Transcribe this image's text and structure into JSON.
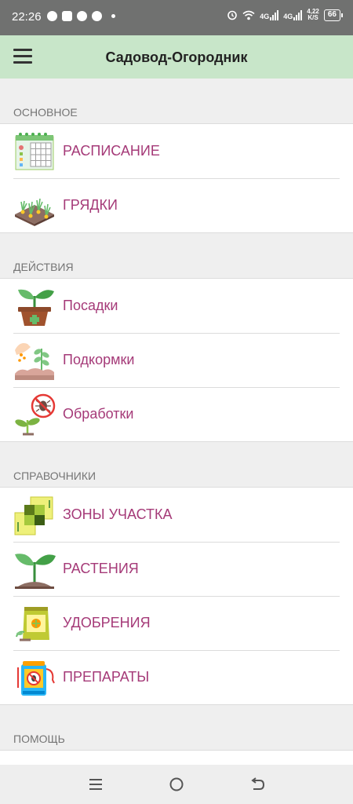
{
  "status_bar": {
    "time": "22:26",
    "net_speed_value": "4,22",
    "net_speed_unit": "K/S",
    "net_type_1": "4G",
    "net_type_2": "4G",
    "battery": "66"
  },
  "app_bar": {
    "title": "Садовод-Огородник",
    "menu_icon": "hamburger-icon",
    "background": "#c8e6c9"
  },
  "colors": {
    "item_text": "#a53a78",
    "section_text": "#757575"
  },
  "sections": [
    {
      "title": "ОСНОВНОЕ",
      "items": [
        {
          "label": "РАСПИСАНИЕ",
          "icon": "calendar-icon"
        },
        {
          "label": "ГРЯДКИ",
          "icon": "garden-bed-icon"
        }
      ]
    },
    {
      "title": "ДЕЙСТВИЯ",
      "items": [
        {
          "label": "Посадки",
          "icon": "potted-sprout-icon"
        },
        {
          "label": "Подкормки",
          "icon": "fertilizing-icon"
        },
        {
          "label": "Обработки",
          "icon": "pest-treatment-icon"
        }
      ]
    },
    {
      "title": "СПРАВОЧНИКИ",
      "items": [
        {
          "label": "ЗОНЫ УЧАСТКА",
          "icon": "plot-zones-icon"
        },
        {
          "label": "РАСТЕНИЯ",
          "icon": "plant-icon"
        },
        {
          "label": "УДОБРЕНИЯ",
          "icon": "fertilizer-bag-icon"
        },
        {
          "label": "ПРЕПАРАТЫ",
          "icon": "sprayer-icon"
        }
      ]
    },
    {
      "title": "ПОМОЩЬ",
      "items": []
    }
  ],
  "nav_bar": {
    "recents_icon": "recents-icon",
    "home_icon": "home-icon",
    "back_icon": "back-icon"
  }
}
